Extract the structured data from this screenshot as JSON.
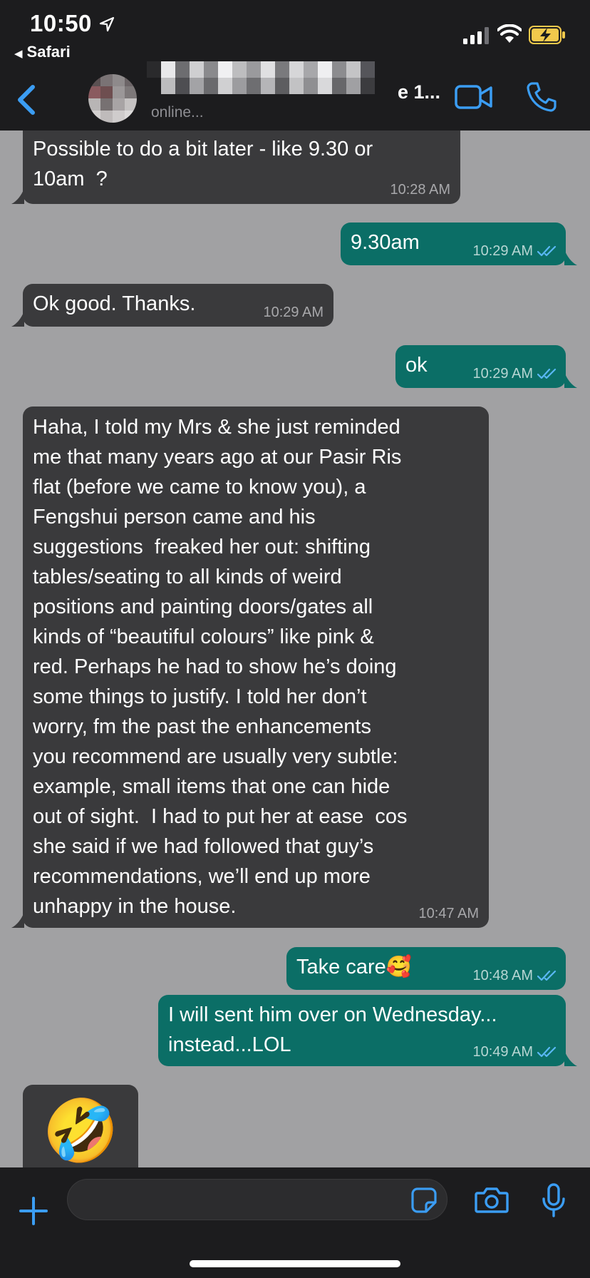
{
  "status_bar": {
    "time": "10:50",
    "back_app": "Safari"
  },
  "header": {
    "contact_name_suffix": "e 1...",
    "contact_status": "online..."
  },
  "messages": [
    {
      "direction": "in",
      "text": "Possible to do a bit later - like 9.30 or\n10am  ?",
      "time": "10:28 AM"
    },
    {
      "direction": "out",
      "text": "9.30am",
      "time": "10:29 AM",
      "ticks": "read"
    },
    {
      "direction": "in",
      "text": "Ok good. Thanks.",
      "time": "10:29 AM"
    },
    {
      "direction": "out",
      "text": "ok",
      "time": "10:29 AM",
      "ticks": "read"
    },
    {
      "direction": "in",
      "text": "Haha, I told my Mrs & she just reminded\nme that many years ago at our Pasir Ris\nflat (before we came to know you), a\nFengshui person came and his\nsuggestions  freaked her out: shifting\ntables/seating to all kinds of weird\npositions and painting doors/gates all\nkinds of “beautiful colours” like pink &\nred. Perhaps he had to show he’s doing\nsome things to justify. I told her don’t\nworry, fm the past the enhancements\nyou recommend are usually very subtle:\nexample, small items that one can hide\nout of sight.  I had to put her at ease  cos\nshe said if we had followed that guy’s\nrecommendations, we’ll end up more\nunhappy in the house.",
      "time": "10:47 AM"
    },
    {
      "direction": "out",
      "text": "Take care🥰",
      "time": "10:48 AM",
      "ticks": "read"
    },
    {
      "direction": "out",
      "text": "I will sent him over on Wednesday...\ninstead...LOL",
      "time": "10:49 AM",
      "ticks": "read"
    },
    {
      "direction": "in",
      "text": "🤣",
      "time": ""
    }
  ],
  "input": {
    "placeholder": "",
    "value": ""
  },
  "colors": {
    "header_bg": "#1c1c1e",
    "chat_bg": "#a1a1a3",
    "incoming_bubble": "#3a3a3c",
    "outgoing_bubble": "#0b6e66",
    "accent_blue": "#3b9df3",
    "read_tick": "#5ab8f5"
  }
}
